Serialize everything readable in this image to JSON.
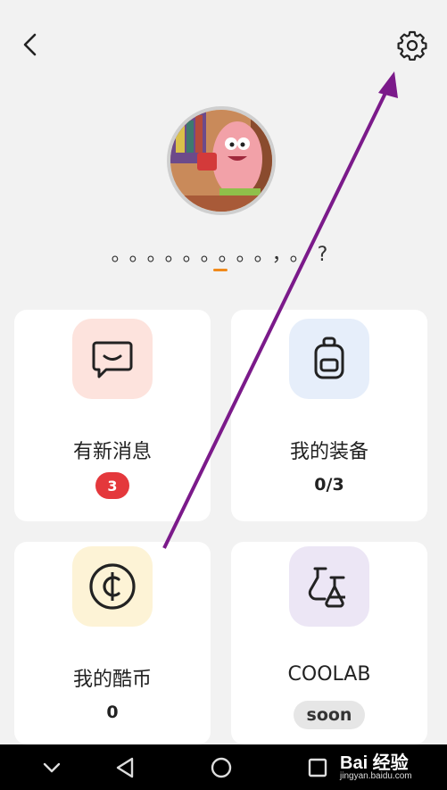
{
  "header": {
    "back_icon": "back-arrow-icon",
    "settings_icon": "gear-icon"
  },
  "profile": {
    "username": "。。。。。。。。。，。?"
  },
  "cards": [
    {
      "title": "有新消息",
      "badge": "3",
      "icon": "message-icon",
      "icon_bg": "#fde3dd"
    },
    {
      "title": "我的装备",
      "value": "0/3",
      "icon": "backpack-icon",
      "icon_bg": "#e6eefa"
    },
    {
      "title": "我的酷币",
      "value": "0",
      "icon": "coin-icon",
      "icon_bg": "#fdf3d6"
    },
    {
      "title": "COOLAB",
      "pill": "soon",
      "icon": "flask-icon",
      "icon_bg": "#ece6f5"
    }
  ],
  "navbar": {
    "buttons": [
      "chevron-down-icon",
      "back-triangle-icon",
      "home-circle-icon",
      "recents-square-icon"
    ]
  },
  "watermark": {
    "text": "Bai 经验",
    "sub": "jingyan.baidu.com"
  },
  "colors": {
    "accent_underline": "#f08a1c",
    "badge_red": "#e4383c",
    "annotation_arrow": "#7b1a8a"
  }
}
